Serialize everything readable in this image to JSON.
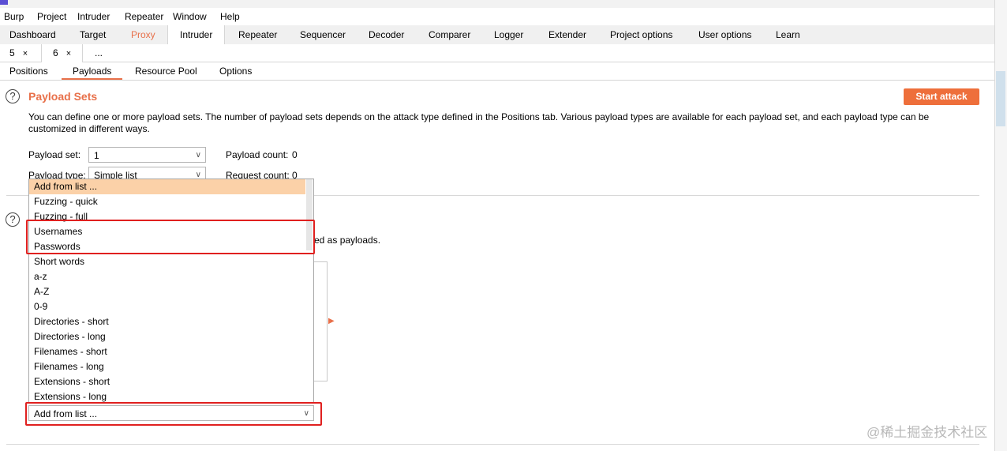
{
  "menu": [
    "Burp",
    "Project",
    "Intruder",
    "Repeater",
    "Window",
    "Help"
  ],
  "main_tabs": [
    "Dashboard",
    "Target",
    "Proxy",
    "Intruder",
    "Repeater",
    "Sequencer",
    "Decoder",
    "Comparer",
    "Logger",
    "Extender",
    "Project options",
    "User options",
    "Learn"
  ],
  "active_main_tab": "Intruder",
  "attack_tabs": [
    {
      "label": "5",
      "close": "×"
    },
    {
      "label": "6",
      "close": "×"
    },
    {
      "label": "..."
    }
  ],
  "config_tabs": [
    "Positions",
    "Payloads",
    "Resource Pool",
    "Options"
  ],
  "active_config_tab": "Payloads",
  "payload_sets": {
    "title": "Payload Sets",
    "start_attack": "Start attack",
    "description": "You can define one or more payload sets. The number of payload sets depends on the attack type defined in the Positions tab. Various payload types are available for each payload set, and each payload type can be customized in different ways.",
    "payload_set_label": "Payload set:",
    "payload_set_value": "1",
    "payload_count_label": "Payload count:",
    "payload_count_value": "0",
    "payload_type_label": "Payload type:",
    "payload_type_value": "Simple list",
    "request_count_label": "Request count:",
    "request_count_value": "0"
  },
  "options_fragment": "ed as payloads.",
  "dropdown_options": [
    "Add from list ...",
    "Fuzzing - quick",
    "Fuzzing - full",
    "Usernames",
    "Passwords",
    "Short words",
    "a-z",
    "A-Z",
    "0-9",
    "Directories - short",
    "Directories - long",
    "Filenames - short",
    "Filenames - long",
    "Extensions - short",
    "Extensions - long"
  ],
  "add_from_list_combo": "Add from list ...",
  "watermark": "@稀土掘金技术社区",
  "colors": {
    "accent": "#e8704a",
    "highlight": "#fbd1a8",
    "annotation": "#e0201f"
  }
}
